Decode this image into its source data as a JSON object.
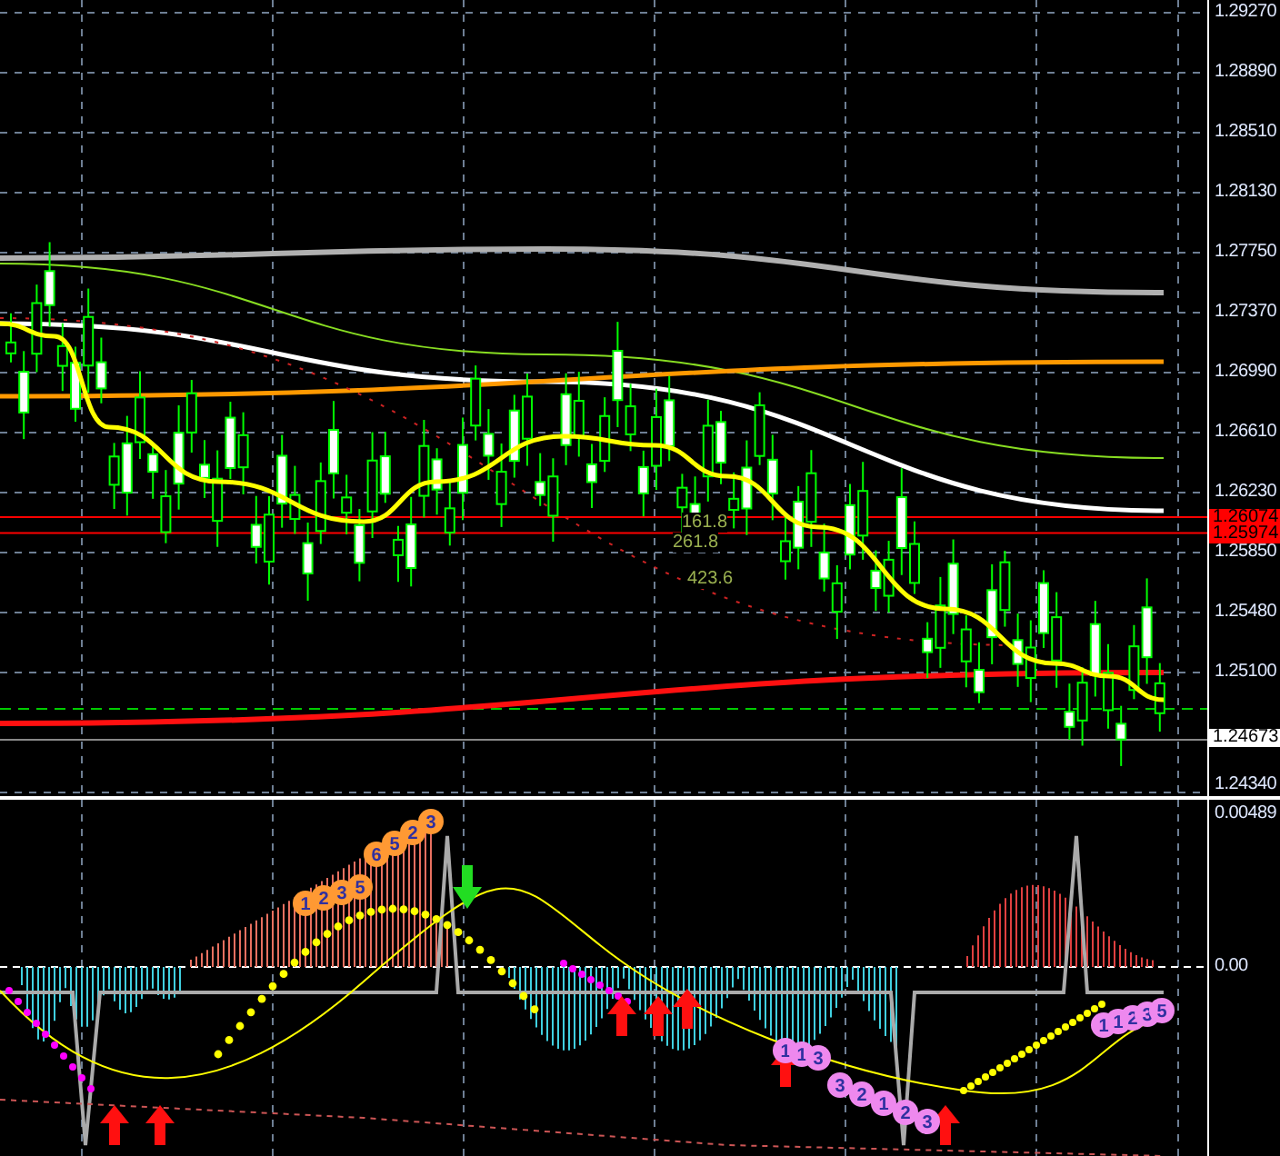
{
  "price_chart": {
    "fib_labels": [
      "161.8",
      "261.8",
      "423.6"
    ]
  },
  "price_axis": {
    "ticks": [
      "1.29270",
      "1.28890",
      "1.28510",
      "1.28130",
      "1.27750",
      "1.27370",
      "1.26990",
      "1.26610",
      "1.26230",
      "1.25850",
      "1.25480",
      "1.25100",
      "1.24340"
    ],
    "tags": [
      {
        "label": "1.26074",
        "color": "#ff0000"
      },
      {
        "label": "1.25974",
        "color": "#ff0000"
      },
      {
        "label": "1.24673",
        "color": "#ffffff"
      }
    ]
  },
  "indicator": {
    "marker_groups": [
      {
        "color": "#ff9933",
        "labels": [
          "1",
          "2",
          "3",
          "5"
        ]
      },
      {
        "color": "#ff9933",
        "labels": [
          "6",
          "5",
          "2",
          "3"
        ]
      },
      {
        "color": "#ee88ee",
        "labels": [
          "1",
          "1",
          "3"
        ]
      },
      {
        "color": "#ee88ee",
        "labels": [
          "3",
          "2",
          "1",
          "2",
          "3"
        ]
      },
      {
        "color": "#ee88ee",
        "labels": [
          "1",
          "1",
          "2",
          "3",
          "5"
        ]
      }
    ]
  },
  "indicator_axis": {
    "ticks": [
      "0.00489",
      "0.00"
    ]
  }
}
